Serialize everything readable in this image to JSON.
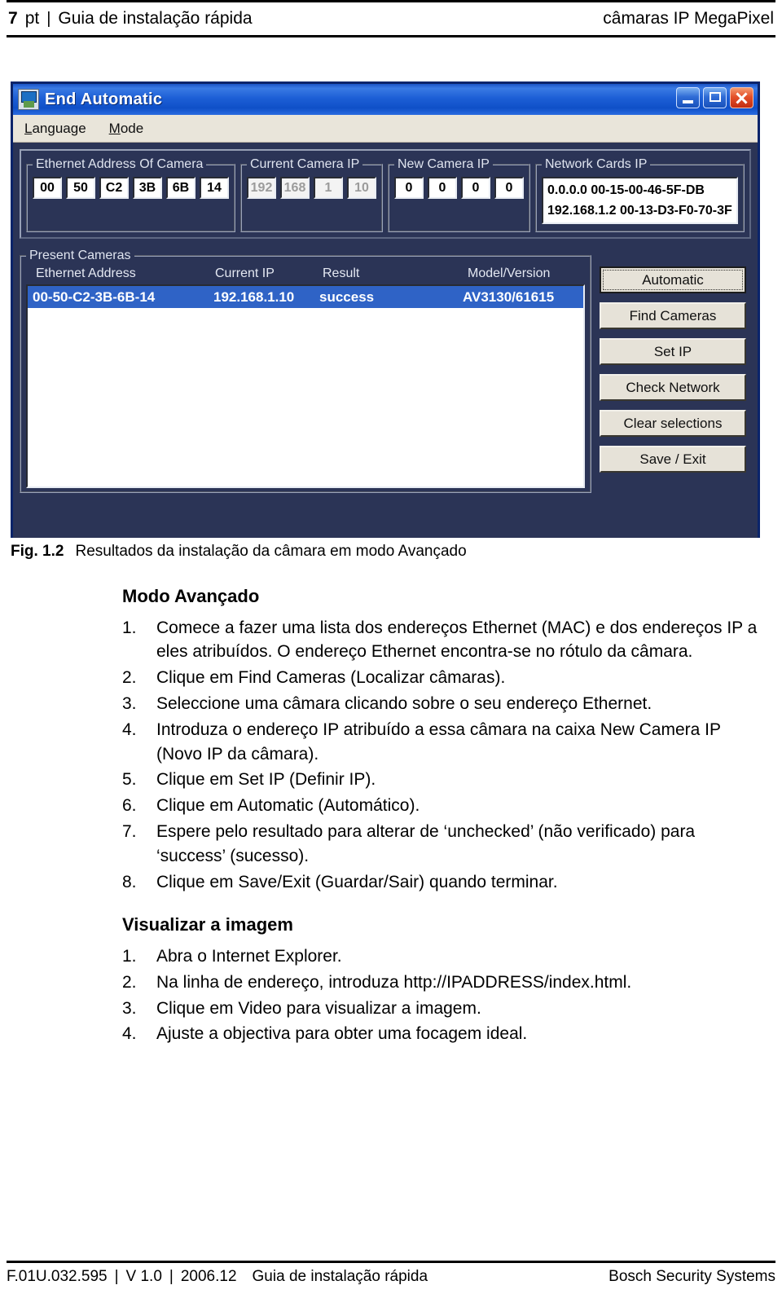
{
  "page_header": {
    "page_number": "7",
    "language_code": "pt",
    "separator": "|",
    "title": "Guia de instalação rápida",
    "product": "câmaras IP MegaPixel"
  },
  "app_window": {
    "title": "End Automatic",
    "icon": "app-icon",
    "window_buttons": {
      "minimize": "minimize-button",
      "maximize": "maximize-button",
      "close": "close-button"
    },
    "menus": [
      {
        "label": "Language",
        "mnemonic": "L",
        "rest": "anguage"
      },
      {
        "label": "Mode",
        "mnemonic": "M",
        "rest": "ode"
      }
    ],
    "ethernet_group": {
      "legend": "Ethernet Address Of Camera",
      "octets": [
        "00",
        "50",
        "C2",
        "3B",
        "6B",
        "14"
      ]
    },
    "current_ip_group": {
      "legend": "Current Camera IP",
      "octets": [
        "192",
        "168",
        "1",
        "10"
      ],
      "disabled": true
    },
    "new_ip_group": {
      "legend": "New Camera IP",
      "octets": [
        "0",
        "0",
        "0",
        "0"
      ]
    },
    "network_cards_group": {
      "legend": "Network Cards IP",
      "lines": [
        "0.0.0.0  00-15-00-46-5F-DB",
        "192.168.1.2  00-13-D3-F0-70-3F"
      ]
    },
    "present_cameras": {
      "legend": "Present Cameras",
      "columns": [
        "Ethernet Address",
        "Current IP",
        "Result",
        "Model/Version"
      ],
      "rows": [
        {
          "ethernet_address": "00-50-C2-3B-6B-14",
          "current_ip": "192.168.1.10",
          "result": "success",
          "model_version": "AV3130/61615",
          "selected": true
        }
      ]
    },
    "buttons": [
      {
        "label": "Automatic",
        "focused": true
      },
      {
        "label": "Find Cameras",
        "focused": false
      },
      {
        "label": "Set IP",
        "focused": false
      },
      {
        "label": "Check Network",
        "focused": false
      },
      {
        "label": "Clear selections",
        "focused": false
      },
      {
        "label": "Save / Exit",
        "focused": false
      }
    ],
    "colors": {
      "titlebar_blue": "#1d5fd6",
      "client_navy": "#2b3456",
      "selection_blue": "#2f63c6",
      "button_face": "#e6e2d8"
    }
  },
  "figure": {
    "label": "Fig. 1.2",
    "caption": "Resultados da instalação da câmara em modo Avançado"
  },
  "sections": [
    {
      "heading": "Modo Avançado",
      "steps": [
        {
          "num": "1.",
          "text": "Comece a fazer uma lista dos endereços Ethernet (MAC) e dos endereços IP a eles atribuídos. O endereço Ethernet encontra-se no rótulo da câmara."
        },
        {
          "num": "2.",
          "text": "Clique em Find Cameras (Localizar câmaras)."
        },
        {
          "num": "3.",
          "text": "Seleccione uma câmara clicando sobre o seu endereço Ethernet."
        },
        {
          "num": "4.",
          "text": "Introduza o endereço IP atribuído a essa câmara na caixa New Camera IP (Novo IP da câmara)."
        },
        {
          "num": "5.",
          "text": "Clique em Set IP (Definir IP)."
        },
        {
          "num": "6.",
          "text": "Clique em Automatic (Automático)."
        },
        {
          "num": "7.",
          "text": "Espere pelo resultado para alterar de ‘unchecked’ (não verificado) para ‘success’ (sucesso)."
        },
        {
          "num": "8.",
          "text": "Clique em Save/Exit (Guardar/Sair) quando terminar."
        }
      ]
    },
    {
      "heading": "Visualizar a imagem",
      "steps": [
        {
          "num": "1.",
          "text": "Abra o Internet Explorer."
        },
        {
          "num": "2.",
          "text": "Na linha de endereço, introduza http://IPADDRESS/index.html."
        },
        {
          "num": "3.",
          "text": "Clique em Video para visualizar a imagem."
        },
        {
          "num": "4.",
          "text": "Ajuste a objectiva para obter uma focagem ideal."
        }
      ]
    }
  ],
  "page_footer": {
    "doc_id": "F.01U.032.595",
    "sep1": "|",
    "version": "V 1.0",
    "sep2": "|",
    "date": "2006.12",
    "title": "Guia de instalação rápida",
    "company": "Bosch Security Systems"
  }
}
